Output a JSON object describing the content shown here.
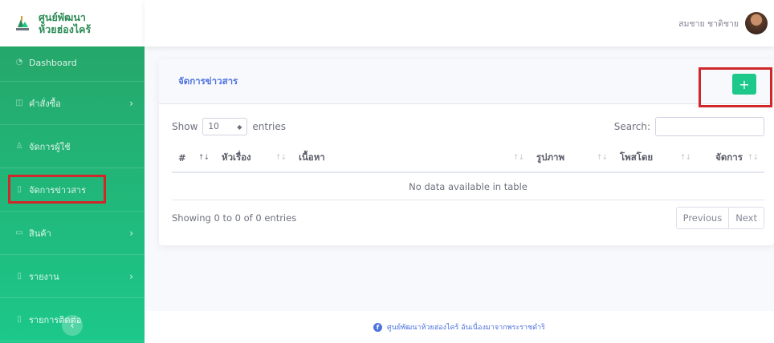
{
  "brand": {
    "line1": "ศูนย์พัฒนา",
    "line2": "ห้วยฮ่องไคร้"
  },
  "sidebar": {
    "items": [
      {
        "icon": "dashboard-icon",
        "glyph": "◔",
        "label": "Dashboard",
        "chevron": ""
      },
      {
        "icon": "cart-icon",
        "glyph": "◫",
        "label": "คำสั่งซื้อ",
        "chevron": "›"
      },
      {
        "icon": "user-icon",
        "glyph": "♙",
        "label": "จัดการผู้ใช้",
        "chevron": ""
      },
      {
        "icon": "news-icon",
        "glyph": "▯",
        "label": "จัดการข่าวสาร",
        "chevron": ""
      },
      {
        "icon": "product-icon",
        "glyph": "▭",
        "label": "สินค้า",
        "chevron": "›"
      },
      {
        "icon": "report-icon",
        "glyph": "▯",
        "label": "รายงาน",
        "chevron": "›"
      },
      {
        "icon": "contact-icon",
        "glyph": "▯",
        "label": "รายการติดต่อ",
        "chevron": ""
      }
    ],
    "toggle": "‹"
  },
  "topbar": {
    "username": "สมชาย ชาติชาย"
  },
  "card": {
    "title": "จัดการข่าวสาร",
    "add_label": "+",
    "show_label": "Show",
    "entries_value": "10",
    "entries_label": "entries",
    "search_label": "Search:",
    "search_value": "",
    "columns": [
      "#",
      "หัวเรื่อง",
      "เนื้อหา",
      "รูปภาพ",
      "โพสโดย",
      "จัดการ"
    ],
    "empty_text": "No data available in table",
    "info": "Showing 0 to 0 of 0 entries",
    "prev": "Previous",
    "next": "Next"
  },
  "footer": {
    "text": "ศูนย์พัฒนาห้วยฮ่องไคร้ อันเนื่องมาจากพระราชดำริ"
  },
  "colors": {
    "primary": "#4e73df",
    "success": "#1cc88a",
    "sidebar": "#27a265",
    "highlight": "#d0272b"
  }
}
